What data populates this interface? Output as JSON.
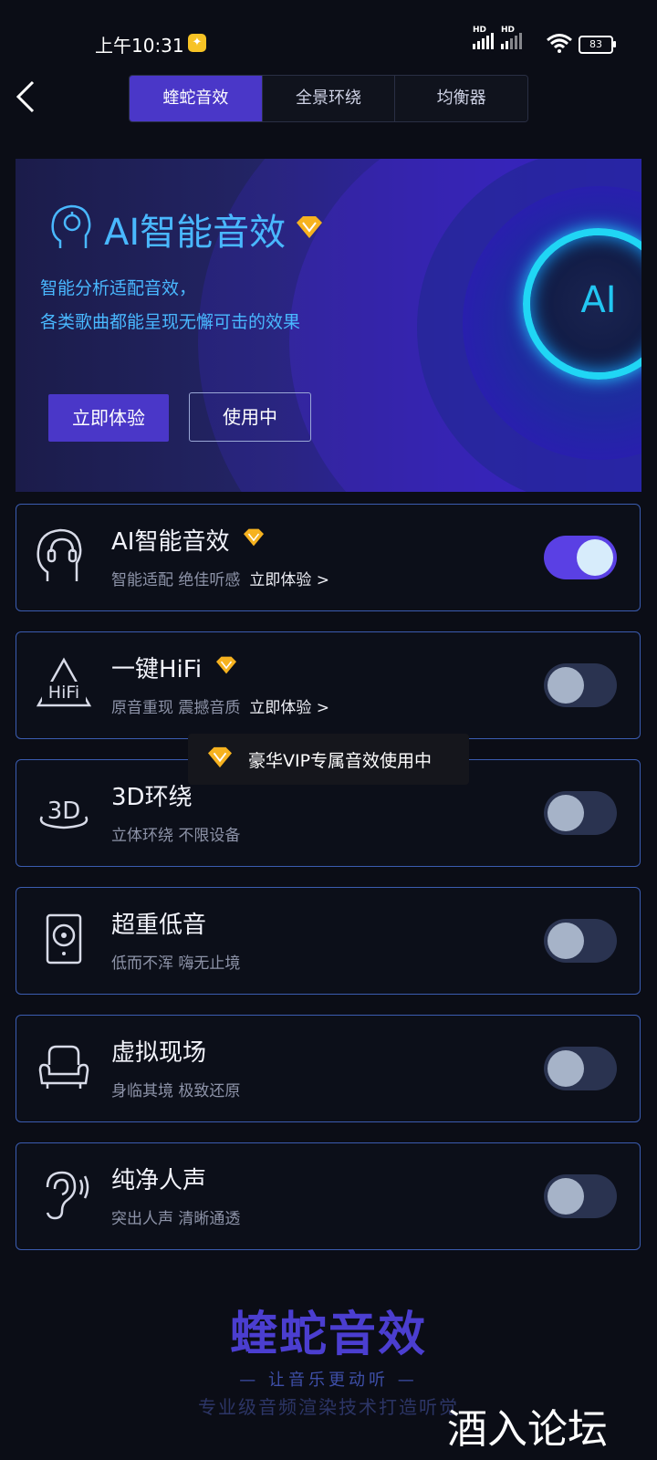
{
  "status_bar": {
    "time": "上午10:31",
    "hd1": "HD",
    "hd2": "HD",
    "battery": "83"
  },
  "header": {
    "back_label": "<",
    "tabs": [
      "蝰蛇音效",
      "全景环绕",
      "均衡器"
    ]
  },
  "banner": {
    "title": "AI智能音效",
    "desc_line1": "智能分析适配音效，",
    "desc_line2": "各类歌曲都能呈现无懈可击的效果",
    "try_button": "立即体验",
    "using_button": "使用中",
    "circle_label": "AI"
  },
  "effects": [
    {
      "title": "AI智能音效",
      "subtitle": "智能适配 绝佳听感",
      "link": "立即体验 >",
      "on": true
    },
    {
      "title": "一键HiFi",
      "subtitle": "原音重现 震撼音质",
      "link": "立即体验 >",
      "on": false
    },
    {
      "title": "3D环绕",
      "subtitle": "立体环绕 不限设备",
      "on": false
    },
    {
      "title": "超重低音",
      "subtitle": "低而不浑 嗨无止境",
      "on": false
    },
    {
      "title": "虚拟现场",
      "subtitle": "身临其境 极致还原",
      "on": false
    },
    {
      "title": "纯净人声",
      "subtitle": "突出人声 清晰通透",
      "on": false
    }
  ],
  "hifi_icon_text": "HiFi",
  "icon_3d_text": "3D",
  "toast": "豪华VIP专属音效使用中",
  "footer": {
    "brand": "蝰蛇音效",
    "slogan": "— 让音乐更动听 —",
    "slogan_sub": "专业级音频渲染技术打造听觉"
  },
  "watermark": "酒入论坛",
  "colors": {
    "accent": "#4a37c8",
    "cyan": "#22c6f2",
    "vip_gold": "#f6b21f",
    "card_border": "#3b5cb0"
  }
}
